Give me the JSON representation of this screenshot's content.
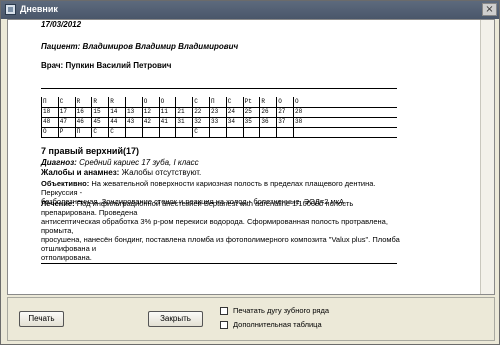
{
  "window": {
    "title": "Дневник",
    "close_glyph": "×"
  },
  "record": {
    "date": "17/03/2012",
    "patient": "Пациент: Владимиров Владимир Владимирович",
    "doctor": "Врач: Пупкин Василий Петрович"
  },
  "dental_chart": {
    "upper_status": [
      "П",
      "С",
      "R",
      "R",
      "R",
      "",
      "О",
      "О",
      "",
      "С",
      "П",
      "С",
      "Pt",
      "R",
      "О",
      "О"
    ],
    "upper_numbers": [
      "18",
      "17",
      "16",
      "15",
      "14",
      "13",
      "12",
      "11",
      "21",
      "22",
      "23",
      "24",
      "25",
      "26",
      "27",
      "28"
    ],
    "lower_numbers": [
      "48",
      "47",
      "46",
      "45",
      "44",
      "43",
      "42",
      "41",
      "31",
      "32",
      "33",
      "34",
      "35",
      "36",
      "37",
      "38"
    ],
    "lower_status": [
      "О",
      "Р",
      "П",
      "С",
      "С",
      "",
      "",
      "",
      "",
      "С",
      "",
      "",
      "",
      "",
      "",
      ""
    ]
  },
  "tooth": {
    "title": "7 правый верхний(17)",
    "diagnosis_label": "Диагноз:",
    "diagnosis_value": "Средний кариес 17 зуба, I класс",
    "complaints_label": "Жалобы и анамнез:",
    "complaints_value": "Жалобы отсутствуют.",
    "objective_label": "Объективно:",
    "objective_l1": "На жевательной поверхности кариозная полость в пределах плащевого дентина. Перкуссия -",
    "objective_l2": "безболезненная. Зондирование стенок и реакция на холод - болезненные. ЭОД=2 мкА.",
    "treatment_label": "Лечение:",
    "treatment_l1": "Под инфильтрационной анестезией Septanest with adrenaline 1/100000 полость препарирована. Проведена",
    "treatment_l2": "антисептическая обработка 3% р-ром перекиси водорода. Сформированная полость протравлена, промыта,",
    "treatment_l3": "просушена, нанесён бондинг, поставлена пломба из фотополимерного композита \"Valux plus\". Пломба отшлифована и",
    "treatment_l4": "отполирована."
  },
  "footer": {
    "print_label": "Печать",
    "close_label": "Закрыть",
    "checkbox_arc": "Печатать дугу зубного ряда",
    "checkbox_table": "Дополнительная таблица"
  }
}
